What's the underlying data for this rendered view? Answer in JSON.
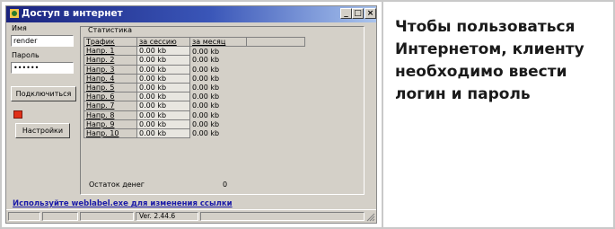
{
  "window": {
    "title": "Доступ в интернет",
    "controls": {
      "minimize": "_",
      "maximize": "□",
      "close": "×"
    }
  },
  "login": {
    "name_label": "Имя",
    "name_value": "render",
    "password_label": "Пароль",
    "password_value": "••••••",
    "connect_button": "Подключиться",
    "settings_button": "Настройки",
    "indicator_color": "#e03018"
  },
  "statistics": {
    "caption": "Статистика",
    "columns": [
      "Трафик",
      "за сессию",
      "за месяц"
    ],
    "rows": [
      [
        "Напр. 1",
        "0.00 kb",
        "0.00 kb"
      ],
      [
        "Напр. 2",
        "0.00 kb",
        "0.00 kb"
      ],
      [
        "Напр. 3",
        "0.00 kb",
        "0.00 kb"
      ],
      [
        "Напр. 4",
        "0.00 kb",
        "0.00 kb"
      ],
      [
        "Напр. 5",
        "0.00 kb",
        "0.00 kb"
      ],
      [
        "Напр. 6",
        "0.00 kb",
        "0.00 kb"
      ],
      [
        "Напр. 7",
        "0.00 kb",
        "0.00 kb"
      ],
      [
        "Напр. 8",
        "0.00 kb",
        "0.00 kb"
      ],
      [
        "Напр. 9",
        "0.00 kb",
        "0.00 kb"
      ],
      [
        "Напр. 10",
        "0.00 kb",
        "0.00 kb"
      ]
    ],
    "balance_label": "Остаток денег",
    "balance_value": "0"
  },
  "link_text": "Используйте weblabel.exe для изменения ссылки",
  "statusbar": {
    "version": "Ver. 2.44.6"
  },
  "caption_lines": [
    "Чтобы пользоваться",
    "Интернетом, клиенту",
    "необходимо ввести",
    "логин и пароль"
  ]
}
